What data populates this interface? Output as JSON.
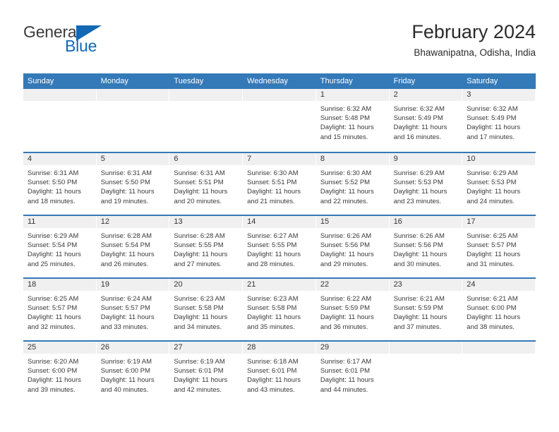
{
  "brand": {
    "name_part1": "General",
    "name_part2": "Blue",
    "triangle_icon": "triangle-icon",
    "accent_color": "#1268b3"
  },
  "header": {
    "title": "February 2024",
    "subtitle": "Bhawanipatna, Odisha, India"
  },
  "theme": {
    "header_bar_color": "#3479b8",
    "day_head_color": "#f0f0f0",
    "row_divider_color": "#3479b8"
  },
  "calendar": {
    "weekday_headers": [
      "Sunday",
      "Monday",
      "Tuesday",
      "Wednesday",
      "Thursday",
      "Friday",
      "Saturday"
    ],
    "labels": {
      "sunrise": "Sunrise:",
      "sunset": "Sunset:",
      "daylight": "Daylight:"
    },
    "weeks": [
      [
        {
          "day": "",
          "empty": true
        },
        {
          "day": "",
          "empty": true
        },
        {
          "day": "",
          "empty": true
        },
        {
          "day": "",
          "empty": true
        },
        {
          "day": "1",
          "sunrise": "Sunrise: 6:32 AM",
          "sunset": "Sunset: 5:48 PM",
          "daylight_line1": "Daylight: 11 hours",
          "daylight_line2": "and 15 minutes."
        },
        {
          "day": "2",
          "sunrise": "Sunrise: 6:32 AM",
          "sunset": "Sunset: 5:49 PM",
          "daylight_line1": "Daylight: 11 hours",
          "daylight_line2": "and 16 minutes."
        },
        {
          "day": "3",
          "sunrise": "Sunrise: 6:32 AM",
          "sunset": "Sunset: 5:49 PM",
          "daylight_line1": "Daylight: 11 hours",
          "daylight_line2": "and 17 minutes."
        }
      ],
      [
        {
          "day": "4",
          "sunrise": "Sunrise: 6:31 AM",
          "sunset": "Sunset: 5:50 PM",
          "daylight_line1": "Daylight: 11 hours",
          "daylight_line2": "and 18 minutes."
        },
        {
          "day": "5",
          "sunrise": "Sunrise: 6:31 AM",
          "sunset": "Sunset: 5:50 PM",
          "daylight_line1": "Daylight: 11 hours",
          "daylight_line2": "and 19 minutes."
        },
        {
          "day": "6",
          "sunrise": "Sunrise: 6:31 AM",
          "sunset": "Sunset: 5:51 PM",
          "daylight_line1": "Daylight: 11 hours",
          "daylight_line2": "and 20 minutes."
        },
        {
          "day": "7",
          "sunrise": "Sunrise: 6:30 AM",
          "sunset": "Sunset: 5:51 PM",
          "daylight_line1": "Daylight: 11 hours",
          "daylight_line2": "and 21 minutes."
        },
        {
          "day": "8",
          "sunrise": "Sunrise: 6:30 AM",
          "sunset": "Sunset: 5:52 PM",
          "daylight_line1": "Daylight: 11 hours",
          "daylight_line2": "and 22 minutes."
        },
        {
          "day": "9",
          "sunrise": "Sunrise: 6:29 AM",
          "sunset": "Sunset: 5:53 PM",
          "daylight_line1": "Daylight: 11 hours",
          "daylight_line2": "and 23 minutes."
        },
        {
          "day": "10",
          "sunrise": "Sunrise: 6:29 AM",
          "sunset": "Sunset: 5:53 PM",
          "daylight_line1": "Daylight: 11 hours",
          "daylight_line2": "and 24 minutes."
        }
      ],
      [
        {
          "day": "11",
          "sunrise": "Sunrise: 6:29 AM",
          "sunset": "Sunset: 5:54 PM",
          "daylight_line1": "Daylight: 11 hours",
          "daylight_line2": "and 25 minutes."
        },
        {
          "day": "12",
          "sunrise": "Sunrise: 6:28 AM",
          "sunset": "Sunset: 5:54 PM",
          "daylight_line1": "Daylight: 11 hours",
          "daylight_line2": "and 26 minutes."
        },
        {
          "day": "13",
          "sunrise": "Sunrise: 6:28 AM",
          "sunset": "Sunset: 5:55 PM",
          "daylight_line1": "Daylight: 11 hours",
          "daylight_line2": "and 27 minutes."
        },
        {
          "day": "14",
          "sunrise": "Sunrise: 6:27 AM",
          "sunset": "Sunset: 5:55 PM",
          "daylight_line1": "Daylight: 11 hours",
          "daylight_line2": "and 28 minutes."
        },
        {
          "day": "15",
          "sunrise": "Sunrise: 6:26 AM",
          "sunset": "Sunset: 5:56 PM",
          "daylight_line1": "Daylight: 11 hours",
          "daylight_line2": "and 29 minutes."
        },
        {
          "day": "16",
          "sunrise": "Sunrise: 6:26 AM",
          "sunset": "Sunset: 5:56 PM",
          "daylight_line1": "Daylight: 11 hours",
          "daylight_line2": "and 30 minutes."
        },
        {
          "day": "17",
          "sunrise": "Sunrise: 6:25 AM",
          "sunset": "Sunset: 5:57 PM",
          "daylight_line1": "Daylight: 11 hours",
          "daylight_line2": "and 31 minutes."
        }
      ],
      [
        {
          "day": "18",
          "sunrise": "Sunrise: 6:25 AM",
          "sunset": "Sunset: 5:57 PM",
          "daylight_line1": "Daylight: 11 hours",
          "daylight_line2": "and 32 minutes."
        },
        {
          "day": "19",
          "sunrise": "Sunrise: 6:24 AM",
          "sunset": "Sunset: 5:57 PM",
          "daylight_line1": "Daylight: 11 hours",
          "daylight_line2": "and 33 minutes."
        },
        {
          "day": "20",
          "sunrise": "Sunrise: 6:23 AM",
          "sunset": "Sunset: 5:58 PM",
          "daylight_line1": "Daylight: 11 hours",
          "daylight_line2": "and 34 minutes."
        },
        {
          "day": "21",
          "sunrise": "Sunrise: 6:23 AM",
          "sunset": "Sunset: 5:58 PM",
          "daylight_line1": "Daylight: 11 hours",
          "daylight_line2": "and 35 minutes."
        },
        {
          "day": "22",
          "sunrise": "Sunrise: 6:22 AM",
          "sunset": "Sunset: 5:59 PM",
          "daylight_line1": "Daylight: 11 hours",
          "daylight_line2": "and 36 minutes."
        },
        {
          "day": "23",
          "sunrise": "Sunrise: 6:21 AM",
          "sunset": "Sunset: 5:59 PM",
          "daylight_line1": "Daylight: 11 hours",
          "daylight_line2": "and 37 minutes."
        },
        {
          "day": "24",
          "sunrise": "Sunrise: 6:21 AM",
          "sunset": "Sunset: 6:00 PM",
          "daylight_line1": "Daylight: 11 hours",
          "daylight_line2": "and 38 minutes."
        }
      ],
      [
        {
          "day": "25",
          "sunrise": "Sunrise: 6:20 AM",
          "sunset": "Sunset: 6:00 PM",
          "daylight_line1": "Daylight: 11 hours",
          "daylight_line2": "and 39 minutes."
        },
        {
          "day": "26",
          "sunrise": "Sunrise: 6:19 AM",
          "sunset": "Sunset: 6:00 PM",
          "daylight_line1": "Daylight: 11 hours",
          "daylight_line2": "and 40 minutes."
        },
        {
          "day": "27",
          "sunrise": "Sunrise: 6:19 AM",
          "sunset": "Sunset: 6:01 PM",
          "daylight_line1": "Daylight: 11 hours",
          "daylight_line2": "and 42 minutes."
        },
        {
          "day": "28",
          "sunrise": "Sunrise: 6:18 AM",
          "sunset": "Sunset: 6:01 PM",
          "daylight_line1": "Daylight: 11 hours",
          "daylight_line2": "and 43 minutes."
        },
        {
          "day": "29",
          "sunrise": "Sunrise: 6:17 AM",
          "sunset": "Sunset: 6:01 PM",
          "daylight_line1": "Daylight: 11 hours",
          "daylight_line2": "and 44 minutes."
        },
        {
          "day": "",
          "empty": true
        },
        {
          "day": "",
          "empty": true
        }
      ]
    ]
  }
}
